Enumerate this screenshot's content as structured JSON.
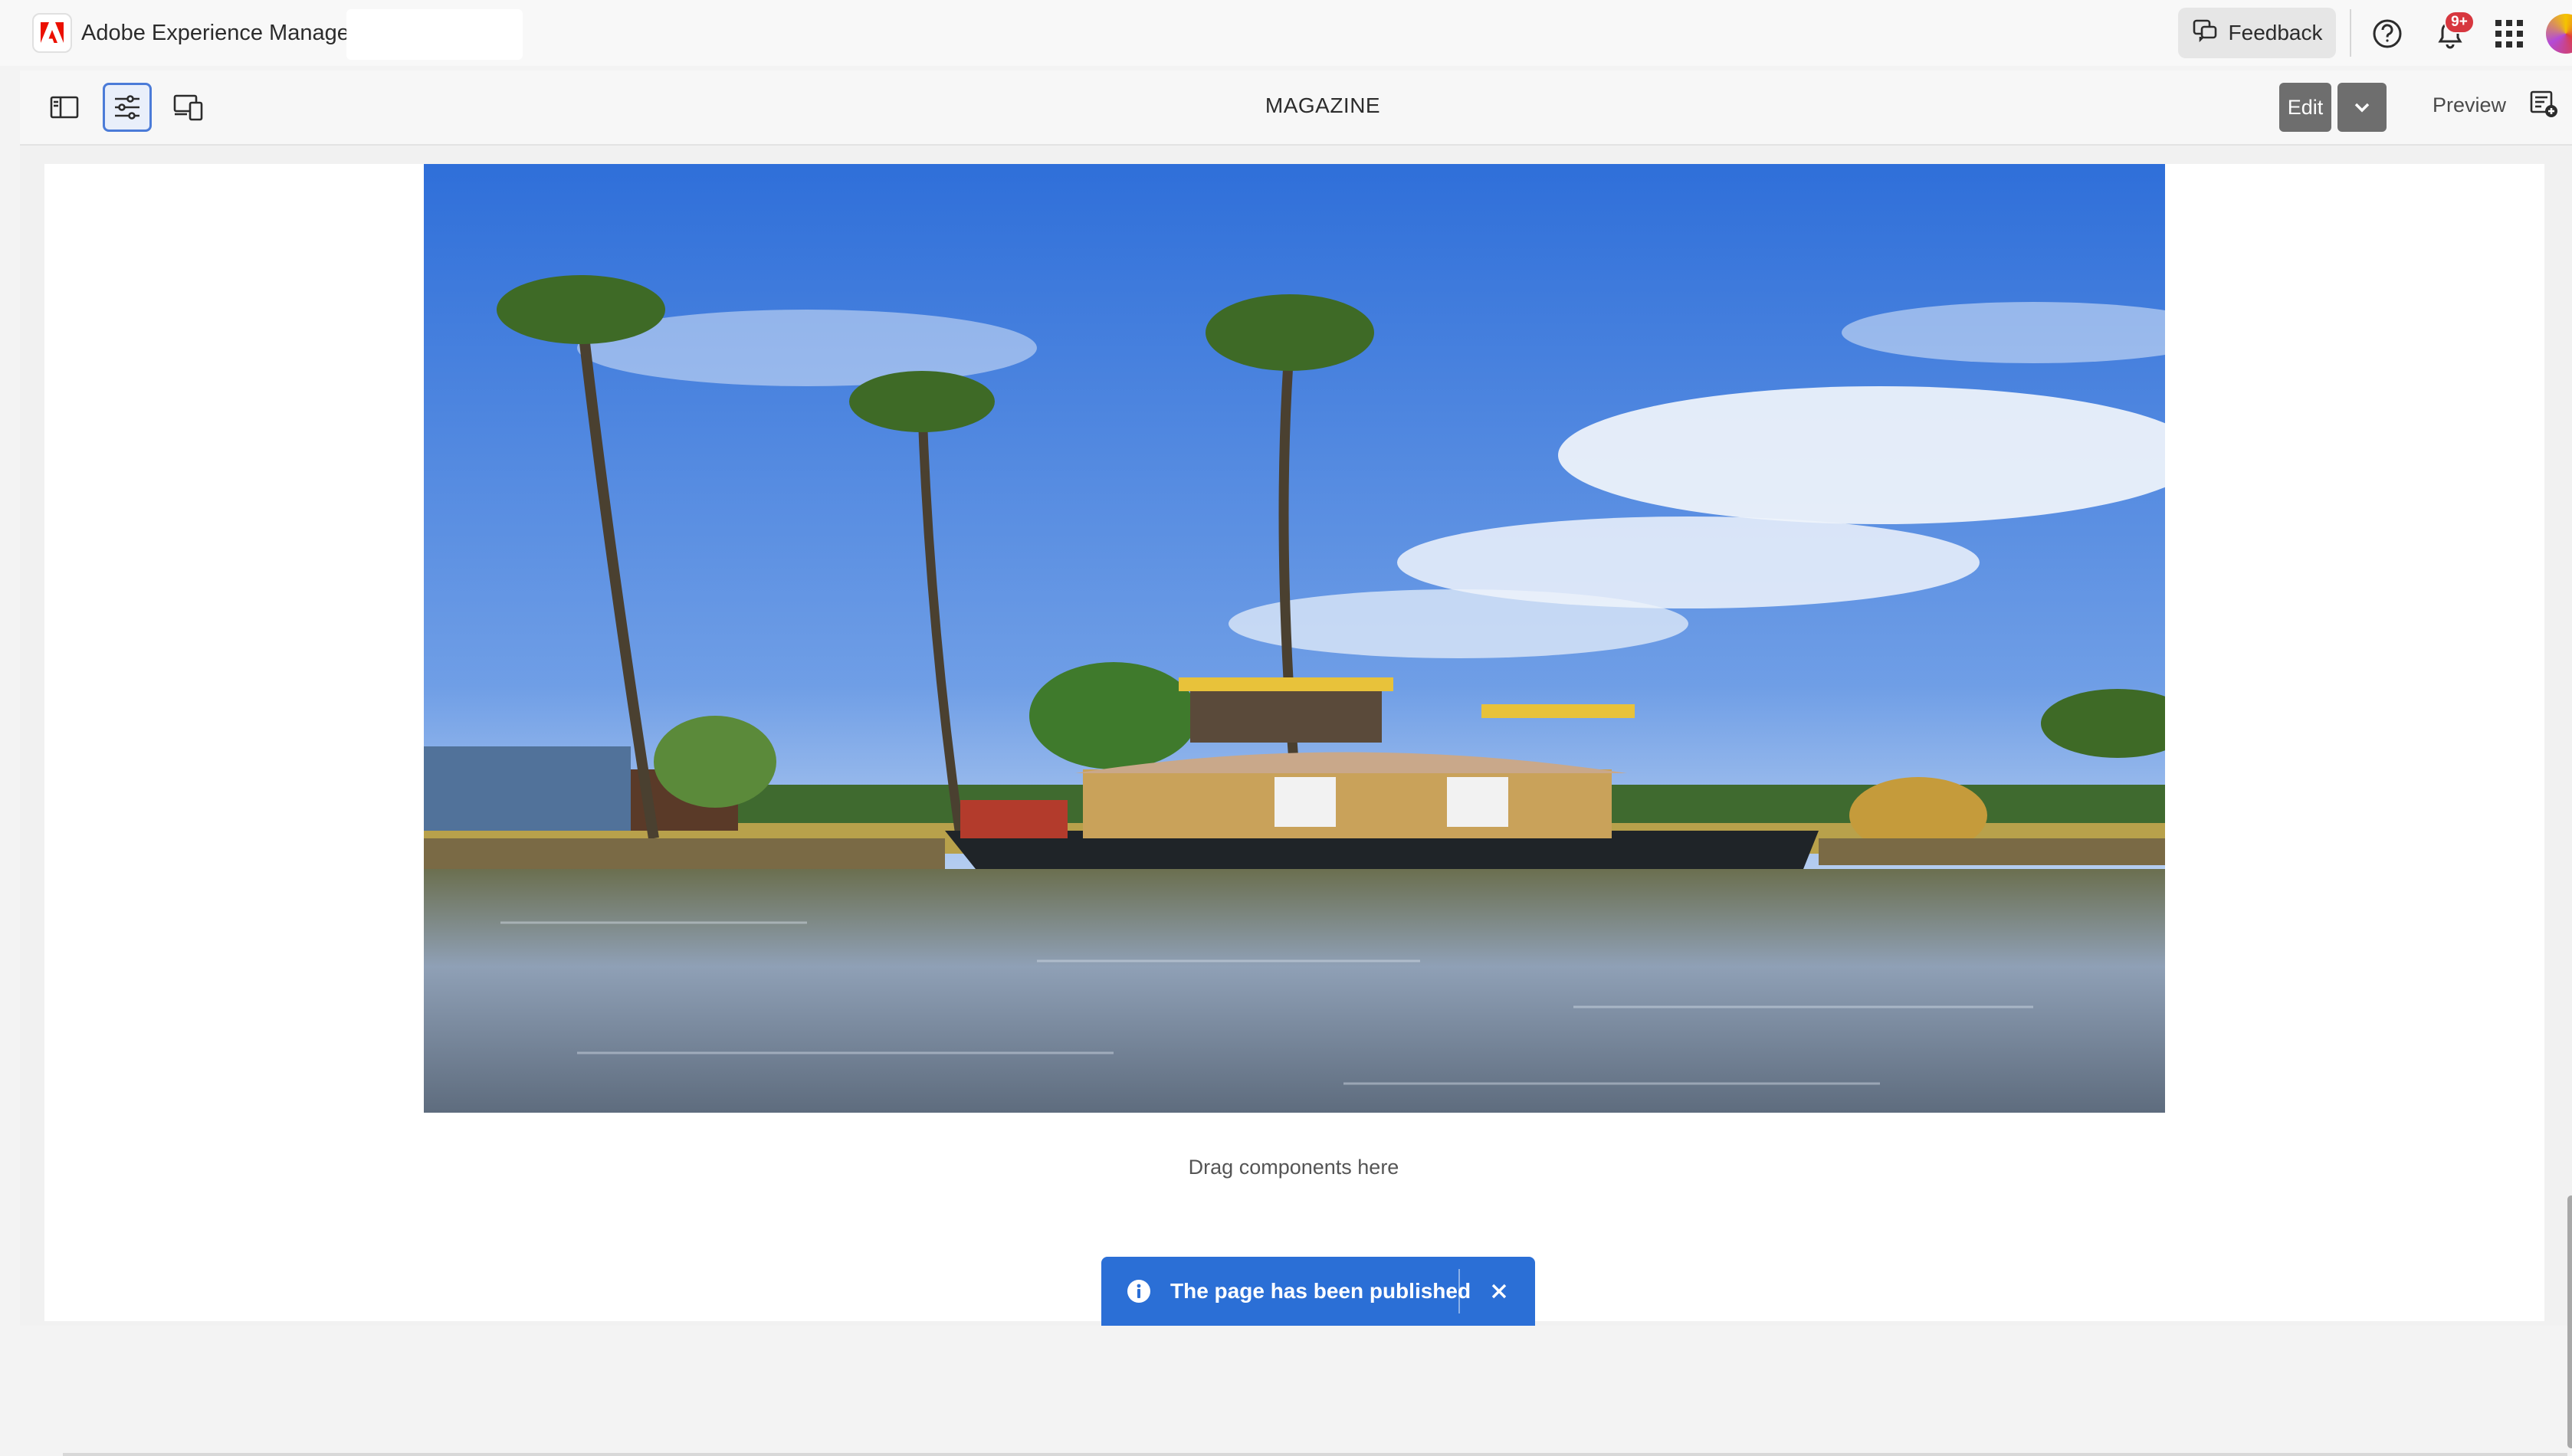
{
  "app": {
    "name": "Adobe Experience Manager",
    "logo_icon": "adobe-logo-icon",
    "brand_color": "#eb1000"
  },
  "header": {
    "feedback_label": "Feedback",
    "notifications_badge": "9+",
    "icons": [
      "help-icon",
      "bell-icon",
      "apps-grid-icon",
      "avatar"
    ]
  },
  "toolbar": {
    "page_title": "MAGAZINE",
    "edit_label": "Edit",
    "preview_label": "Preview",
    "tools": [
      "side-panel-toggle-icon",
      "page-properties-sliders-icon",
      "emulator-devices-icon"
    ],
    "active_tool": "page-properties-sliders-icon"
  },
  "canvas": {
    "image_alt": "Houseboat on the backwaters with coconut palms",
    "dropzone_text": "Drag components here"
  },
  "toast": {
    "message": "The page has been published",
    "color": "#2b6fd6"
  }
}
